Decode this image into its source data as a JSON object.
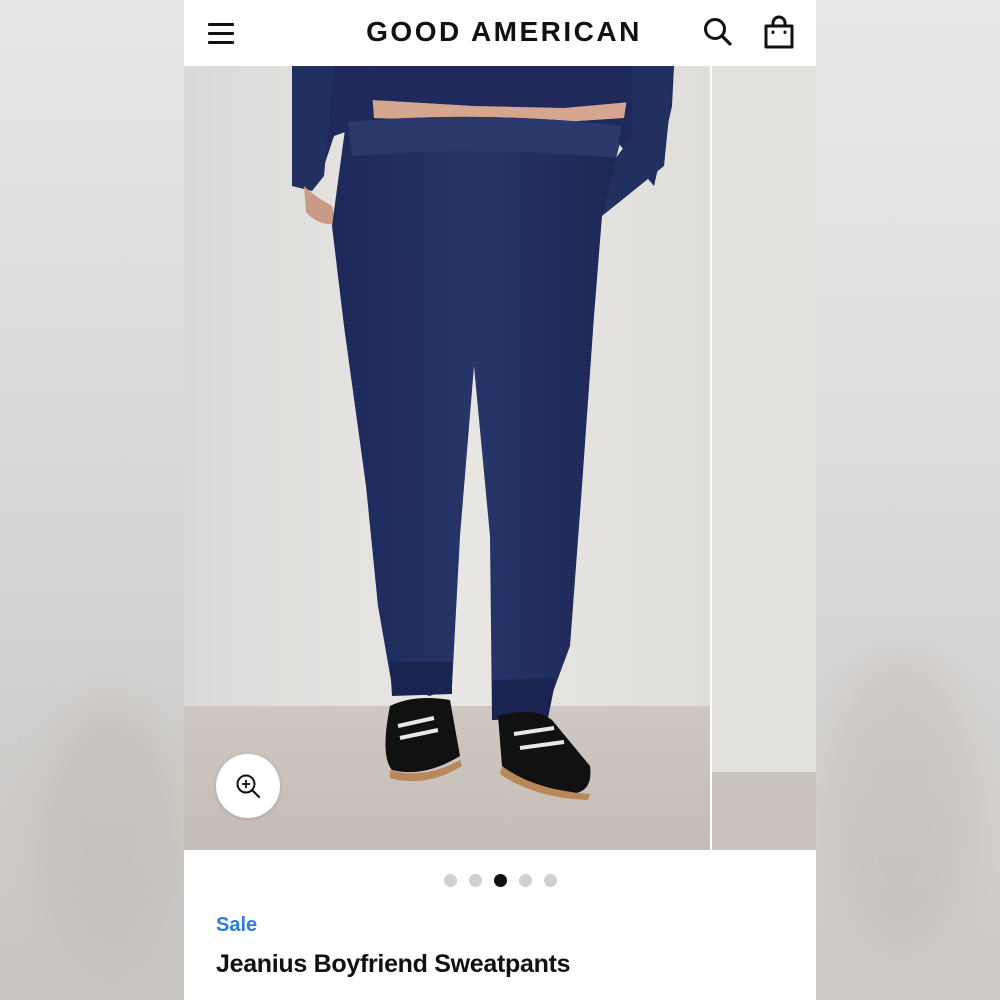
{
  "header": {
    "brand": "GOOD AMERICAN",
    "menu_icon": "hamburger-menu-icon",
    "search_icon": "search-icon",
    "bag_icon": "shopping-bag-icon"
  },
  "gallery": {
    "slide_count": 5,
    "active_slide": 3,
    "zoom_icon": "zoom-in-icon"
  },
  "product": {
    "badge": "Sale",
    "name": "Jeanius Boyfriend Sweatpants"
  },
  "colors": {
    "sale_blue": "#2b7dd6",
    "denim": "#1f2c5c",
    "text": "#111111"
  }
}
